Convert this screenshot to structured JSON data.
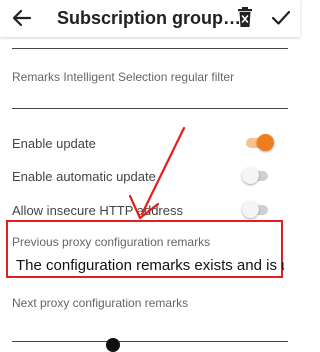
{
  "header": {
    "title": "Subscription group s...",
    "back_icon": "arrow-left-icon",
    "delete_icon": "trash-delete-icon",
    "confirm_icon": "check-icon"
  },
  "fields": {
    "filter_label": "Remarks Intelligent Selection regular filter",
    "filter_value": "",
    "enable_update_label": "Enable update",
    "enable_update_on": true,
    "auto_update_label": "Enable automatic update",
    "auto_update_on": false,
    "insecure_http_label": "Allow insecure HTTP address",
    "insecure_http_on": false,
    "prev_proxy_label": "Previous proxy configuration remarks",
    "prev_proxy_value": "The configuration remarks exists and is unique",
    "next_proxy_label": "Next proxy configuration remarks",
    "next_proxy_value": ""
  },
  "colors": {
    "accent": "#f07c1e",
    "annotation": "#e02020"
  }
}
